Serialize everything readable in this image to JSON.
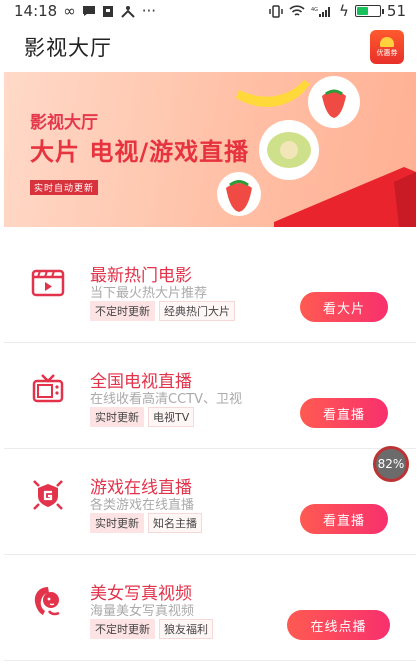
{
  "status_bar": {
    "time": "14:18",
    "battery_level": "51",
    "battery_fraction": 0.51
  },
  "header": {
    "title": "影视大厅",
    "coupon_label": "优惠券"
  },
  "banner": {
    "subtitle": "影视大厅",
    "headline": "大片 电视/游戏直播",
    "tag": "实时自动更新"
  },
  "items": [
    {
      "icon": "film-icon",
      "name": "最新热门电影",
      "desc": "当下最火热大片推荐",
      "tags": [
        "不定时更新",
        "经典热门大片"
      ],
      "button": "看大片"
    },
    {
      "icon": "tv-icon",
      "name": "全国电视直播",
      "desc": "在线收看高清CCTV、卫视",
      "tags": [
        "实时更新",
        "电视TV"
      ],
      "button": "看直播"
    },
    {
      "icon": "game-shield-icon",
      "name": "游戏在线直播",
      "desc": "各类游戏在线直播",
      "tags": [
        "实时更新",
        "知名主播"
      ],
      "button": "看直播"
    },
    {
      "icon": "beauty-icon",
      "name": "美女写真视频",
      "desc": "海量美女写真视频",
      "tags": [
        "不定时更新",
        "狼友福利"
      ],
      "button": "在线点播"
    }
  ],
  "floating_badge": "82%",
  "colors": {
    "accent": "#e2334b",
    "button_start": "#ff5a52",
    "button_end": "#f8306d"
  }
}
